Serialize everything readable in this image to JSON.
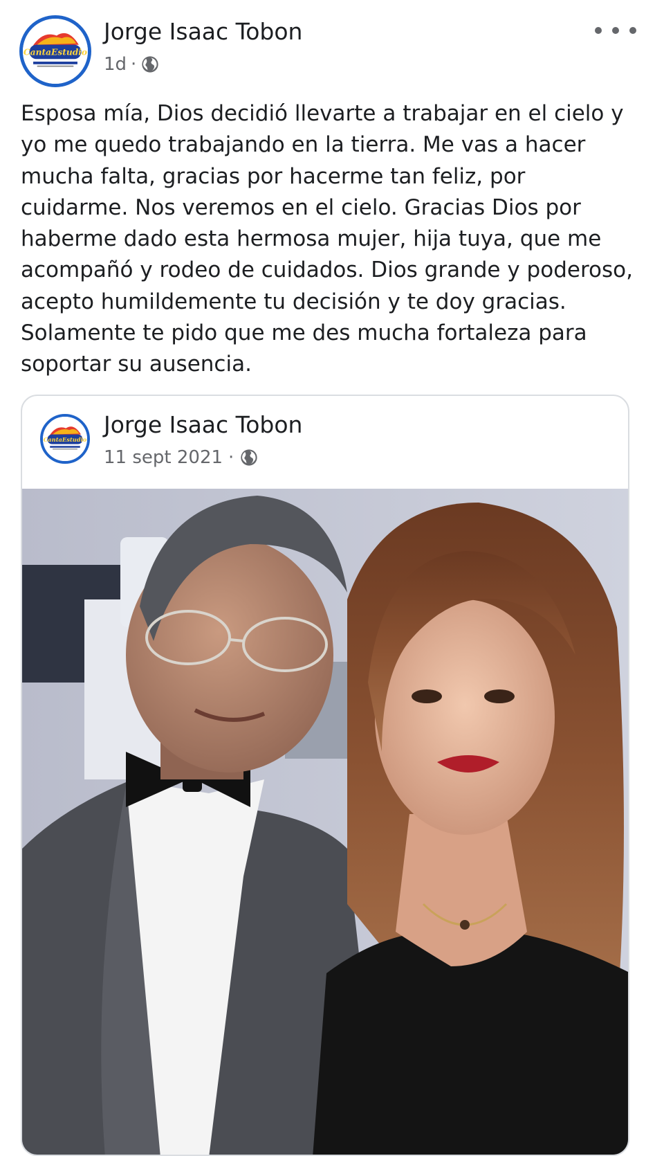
{
  "post": {
    "author": "Jorge Isaac Tobon",
    "time": "1d",
    "separator": "·",
    "privacy_icon": "globe-icon",
    "more_icon": "more-options-icon",
    "text": "Esposa mía, Dios decidió llevarte a trabajar en el cielo y\nyo me quedo trabajando en la tierra. Me vas a hacer\nmucha falta, gracias por hacerme tan feliz, por\ncuidarme. Nos veremos en el cielo. Gracias Dios por\nhaberme dado esta hermosa mujer, hija tuya, que me\nacompañó y rodeo de cuidados. Dios grande y poderoso,\nacepto humildemente tu decisión y te doy gracias.\nSolamente te pido que me des mucha fortaleza para\nsoportar su ausencia."
  },
  "shared": {
    "author": "Jorge Isaac Tobon",
    "date": "11 sept 2021",
    "separator": "·",
    "privacy_icon": "globe-icon"
  },
  "avatar": {
    "logo_text": "CantaEstudio",
    "ring_color": "#1f63c9"
  },
  "colors": {
    "text_primary": "#1c1e21",
    "text_secondary": "#65676b",
    "card_border": "#dadde1"
  }
}
